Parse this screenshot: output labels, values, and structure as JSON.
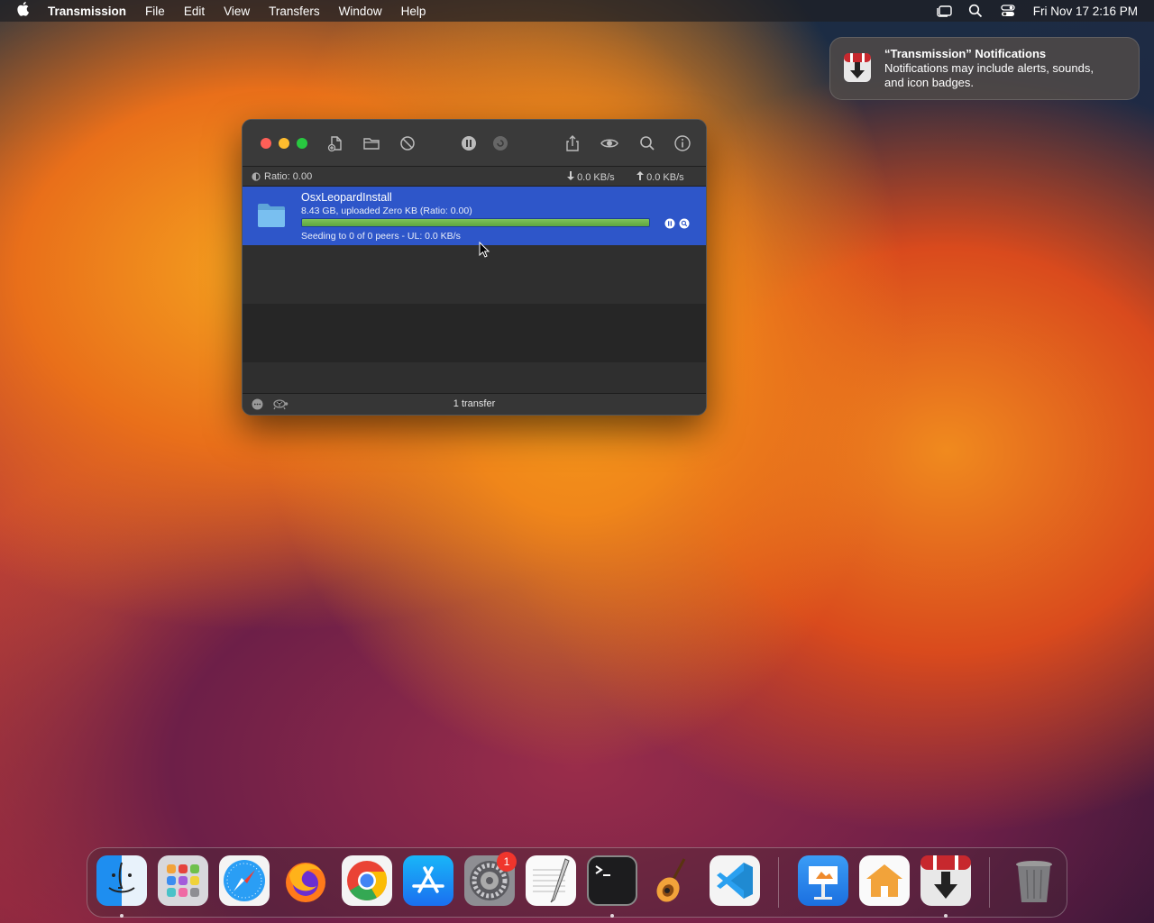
{
  "menubar": {
    "app_name": "Transmission",
    "items": [
      "File",
      "Edit",
      "View",
      "Transfers",
      "Window",
      "Help"
    ],
    "datetime": "Fri Nov 17  2:16 PM"
  },
  "notification": {
    "title": "“Transmission” Notifications",
    "body_line1": "Notifications may include alerts, sounds,",
    "body_line2": "and icon badges."
  },
  "window": {
    "status": {
      "ratio": "Ratio: 0.00",
      "download": "0.0 KB/s",
      "upload": "0.0 KB/s"
    },
    "torrent": {
      "name": "OsxLeopardInstall",
      "info": "8.43 GB, uploaded Zero KB (Ratio: 0.00)",
      "progress": 1.0,
      "status": "Seeding to 0 of 0 peers - UL: 0.0 KB/s"
    },
    "footer": {
      "count": "1 transfer"
    }
  },
  "dock": {
    "settings_badge": "1",
    "apps": [
      "finder",
      "launchpad",
      "safari",
      "firefox",
      "chrome",
      "app-store",
      "system-settings",
      "textedit",
      "terminal",
      "garageband",
      "vscode",
      "keynote",
      "home",
      "transmission",
      "trash"
    ]
  },
  "colors": {
    "selection": "#2e56c9",
    "progress_green": "#6db44c",
    "badge_red": "#f0352c"
  }
}
